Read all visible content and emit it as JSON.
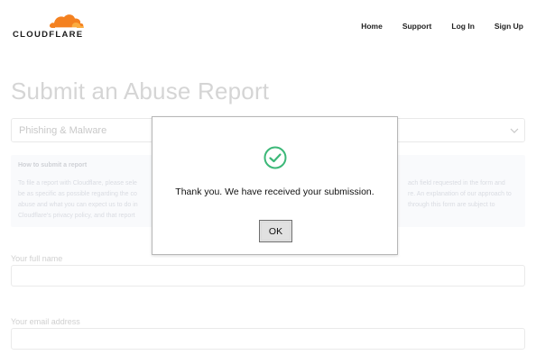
{
  "header": {
    "logo_text": "CLOUDFLARE",
    "brand_color": "#f48120",
    "nav": [
      {
        "label": "Home"
      },
      {
        "label": "Support"
      },
      {
        "label": "Log In"
      },
      {
        "label": "Sign Up"
      }
    ]
  },
  "form": {
    "title": "Submit an Abuse Report",
    "report_type": "Phishing & Malware",
    "info_box": {
      "heading": "How to submit a report",
      "line1_left": "To file a report with Cloudflare, please sele",
      "line1_right": "ach field requested in the form and",
      "line2_left": "be as specific as possible regarding the co",
      "line2_right": "re. An explanation of our approach to",
      "line3_left": "abuse and what you can expect us to do in",
      "line3_right": "through this form are subject to",
      "line4_left": "Cloudflare's privacy policy, and that report"
    },
    "full_name_label": "Your full name",
    "full_name_value": "",
    "email_label": "Your email address",
    "email_value": ""
  },
  "dialog": {
    "message": "Thank you. We have received your submission.",
    "ok_label": "OK",
    "success_color": "#3cb878"
  }
}
